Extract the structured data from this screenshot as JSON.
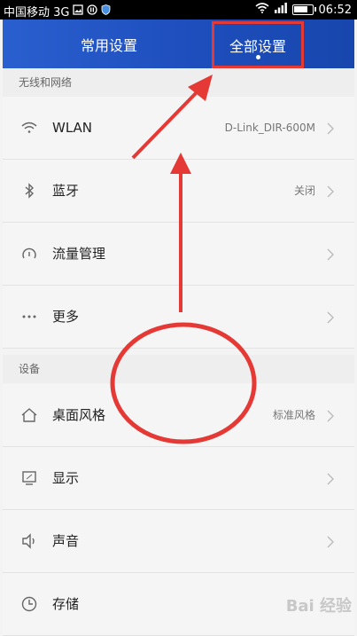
{
  "status_bar": {
    "carrier": "中国移动 3G",
    "time": "06:52",
    "battery_level": 0.8
  },
  "header": {
    "tabs": [
      {
        "label": "常用设置",
        "active": false
      },
      {
        "label": "全部设置",
        "active": true
      }
    ]
  },
  "sections": [
    {
      "title": "无线和网络",
      "items": [
        {
          "icon": "wifi-icon",
          "label": "WLAN",
          "value": "D-Link_DIR-600M"
        },
        {
          "icon": "bluetooth-icon",
          "label": "蓝牙",
          "value": "关闭"
        },
        {
          "icon": "data-usage-icon",
          "label": "流量管理",
          "value": ""
        },
        {
          "icon": "more-icon",
          "label": "更多",
          "value": ""
        }
      ]
    },
    {
      "title": "设备",
      "items": [
        {
          "icon": "home-icon",
          "label": "桌面风格",
          "value": "标准风格"
        },
        {
          "icon": "display-icon",
          "label": "显示",
          "value": ""
        },
        {
          "icon": "sound-icon",
          "label": "声音",
          "value": ""
        },
        {
          "icon": "storage-icon",
          "label": "存储",
          "value": ""
        }
      ]
    }
  ],
  "watermark": "Bai 经验",
  "colors": {
    "header": "#1f4fbe",
    "annotation_red": "#e53935"
  }
}
